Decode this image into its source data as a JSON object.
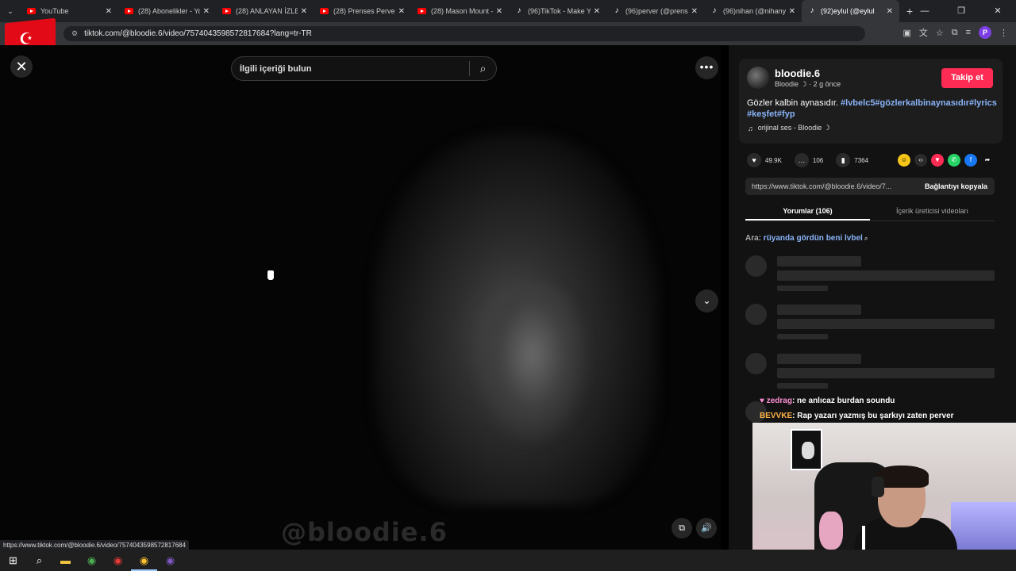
{
  "browser": {
    "tabs": [
      {
        "title": "YouTube",
        "favicon": "youtube-icon"
      },
      {
        "title": "(28) Abonelikler - You",
        "favicon": "youtube-icon"
      },
      {
        "title": "(28) ANLAYAN İZLESİ",
        "favicon": "youtube-icon"
      },
      {
        "title": "(28) Prenses Perver -",
        "favicon": "youtube-icon"
      },
      {
        "title": "(28) Mason Mount –",
        "favicon": "youtube-icon"
      },
      {
        "title": "(96)TikTok - Make Yo",
        "favicon": "tiktok-icon"
      },
      {
        "title": "(96)perver (@prense",
        "favicon": "tiktok-icon"
      },
      {
        "title": "(96)nihan (@nihanysl",
        "favicon": "tiktok-icon"
      },
      {
        "title": "(92)eylul (@eylul",
        "favicon": "tiktok-icon"
      }
    ],
    "url": "tiktok.com/@bloodie.6/video/7574043598572817684?lang=tr-TR",
    "status_url": "https://www.tiktok.com/@bloodie.6/video/7574043598572817684",
    "profile_initial": "P"
  },
  "video": {
    "search_placeholder": "İlgili içeriği bulun",
    "watermark": "@bloodie.6"
  },
  "post": {
    "username": "bloodie.6",
    "nickname": "Bloodie ☽",
    "time": "· 2 g önce",
    "follow_label": "Takip et",
    "caption_text": "Gözler kalbin aynasıdır. ",
    "caption_tags": "#lvbelc5#gözlerkalbinaynasıdır#lyrics #keşfet#fyp",
    "music": "orijinal ses - Bloodie ☽",
    "likes": "49.9K",
    "comments": "106",
    "saves": "7364",
    "share_link": "https://www.tiktok.com/@bloodie.6/video/7...",
    "copy_label": "Bağlantıyı kopyala",
    "tab_comments": "Yorumlar (106)",
    "tab_creator": "İçerik üreticisi videoları",
    "search_prefix": "Ara: ",
    "search_suggestion": "rüyanda gördün beni lvbel"
  },
  "chat": [
    {
      "user": "zedrag",
      "message": ": ne anlıcaz burdan soundu"
    },
    {
      "user": "BEVVKE",
      "message": ": Rap yazarı yazmış bu şarkıyı zaten perver"
    }
  ],
  "colors": {
    "accent": "#fe2c55",
    "link": "#8ab4f8",
    "chat_user1": "#ff8fd6",
    "chat_user2": "#ffb347"
  }
}
